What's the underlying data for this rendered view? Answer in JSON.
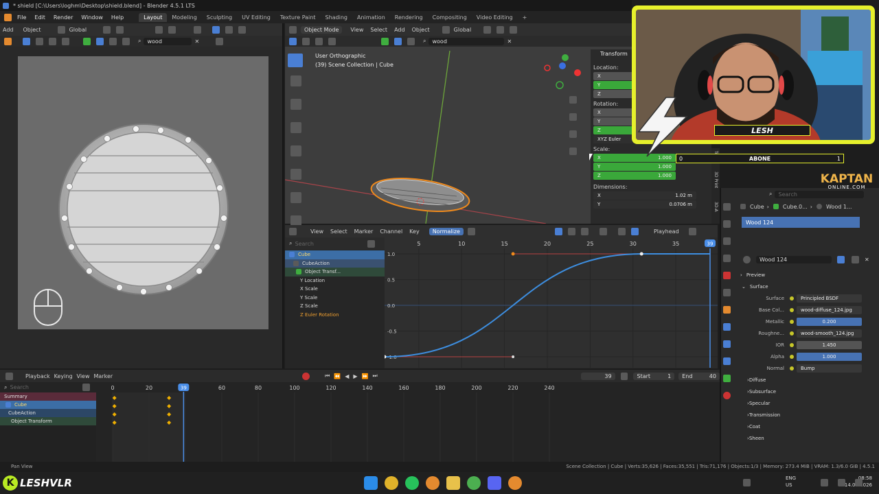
{
  "window": {
    "title": "* shield [C:\\Users\\loghm\\Desktop\\shield.blend] - Blender 4.5.1 LTS"
  },
  "menus": [
    "File",
    "Edit",
    "Render",
    "Window",
    "Help"
  ],
  "workspaces": [
    "Layout",
    "Modeling",
    "Sculpting",
    "UV Editing",
    "Texture Paint",
    "Shading",
    "Animation",
    "Rendering",
    "Compositing",
    "Video Editing"
  ],
  "image_editor": {
    "header_items": [
      "Add",
      "Object",
      "Global"
    ],
    "search_value": "wood"
  },
  "viewport": {
    "mode": "Object Mode",
    "menus": [
      "View",
      "Select",
      "Add",
      "Object"
    ],
    "orientation": "Global",
    "search_value": "wood",
    "overlay_title": "User Orthographic",
    "overlay_subtitle": "(39) Scene Collection | Cube"
  },
  "npanel": {
    "section": "Transform",
    "location_label": "Location:",
    "rotation_label": "Rotation:",
    "rotation_mode": "XYZ Euler",
    "scale_label": "Scale:",
    "scale": {
      "x": "1.000",
      "y": "1.000",
      "z": "1.000"
    },
    "dimensions_label": "Dimensions:",
    "dimensions": {
      "x": "1.02 m",
      "y": "0.0706 m"
    },
    "axes": [
      "X",
      "Y",
      "Z"
    ],
    "tabs": [
      "Tool",
      "3D Print",
      "3D-A"
    ]
  },
  "graph_editor": {
    "menus": [
      "View",
      "Select",
      "Marker",
      "Channel",
      "Key"
    ],
    "normalize_label": "Normalize",
    "playhead_label": "Playhead",
    "search_placeholder": "Search",
    "frame_ticks": [
      "5",
      "10",
      "15",
      "20",
      "25",
      "30",
      "35"
    ],
    "current_frame": "39",
    "y_ticks": [
      "1.0",
      "0.5",
      "0.0",
      "-0.5",
      "-1.0"
    ],
    "channels": [
      {
        "label": "Cube",
        "kind": "object"
      },
      {
        "label": "CubeAction",
        "kind": "action"
      },
      {
        "label": "Object Transf...",
        "kind": "group"
      },
      {
        "label": "Y Location",
        "kind": "fcurve"
      },
      {
        "label": "X Scale",
        "kind": "fcurve"
      },
      {
        "label": "Y Scale",
        "kind": "fcurve"
      },
      {
        "label": "Z Scale",
        "kind": "fcurve"
      },
      {
        "label": "Z Euler Rotation",
        "kind": "fcurve-active"
      }
    ]
  },
  "timeline": {
    "menus": [
      "Playback",
      "Keying",
      "View",
      "Marker"
    ],
    "current_frame": "39",
    "start_label": "Start",
    "start_value": "1",
    "end_label": "End",
    "end_value": "40",
    "search_placeholder": "Search",
    "frame_ticks": [
      "0",
      "20",
      "39",
      "60",
      "80",
      "100",
      "120",
      "140",
      "160",
      "180",
      "200",
      "220",
      "240"
    ],
    "channels": [
      "Summary",
      "Cube",
      "CubeAction",
      "Object Transform"
    ]
  },
  "properties": {
    "search_placeholder": "Search",
    "breadcrumb": [
      "Cube",
      "Cube.0...",
      "Wood 1..."
    ],
    "slot": "Wood 124",
    "material_name": "Wood 124",
    "sections": {
      "preview": "Preview",
      "surface": "Surface"
    },
    "rows": [
      {
        "label": "Surface",
        "value": "Principled BSDF",
        "style": "dark"
      },
      {
        "label": "Base Col...",
        "value": "wood-diffuse_124.jpg",
        "style": "dark"
      },
      {
        "label": "Metallic",
        "value": "0.200",
        "style": "blue"
      },
      {
        "label": "Roughne...",
        "value": "wood-smooth_124.jpg",
        "style": "dark"
      },
      {
        "label": "IOR",
        "value": "1.450",
        "style": "grey"
      },
      {
        "label": "Alpha",
        "value": "1.000",
        "style": "blue"
      },
      {
        "label": "Normal",
        "value": "Bump",
        "style": "dark"
      }
    ],
    "subsections": [
      "Diffuse",
      "Subsurface",
      "Specular",
      "Transmission",
      "Coat",
      "Sheen"
    ]
  },
  "statusbar": {
    "left": "Pan View",
    "right": "Scene Collection | Cube | Verts:35,626 | Faces:35,551 | Tris:71,176 | Objects:1/3 | Memory: 273.4 MiB | VRAM: 1.3/6.0 GiB | 4.5.1"
  },
  "taskbar": {
    "lang": "ENG",
    "region": "US",
    "time": "08:58",
    "date": "14.03.2026"
  },
  "overlays": {
    "streamer_name": "LESH",
    "subscribe_label": "ABONE",
    "subscribe_current": "0",
    "subscribe_goal": "1",
    "brand": "KAPTAN",
    "brand_sub": "ONLINE.COM",
    "bottom_logo": "LESHVLR"
  },
  "colors": {
    "accent_blue": "#4772b3",
    "selection_orange": "#f08a1c",
    "overlay_yellow": "#e6f02c",
    "curve_blue": "#3d8ee0"
  }
}
